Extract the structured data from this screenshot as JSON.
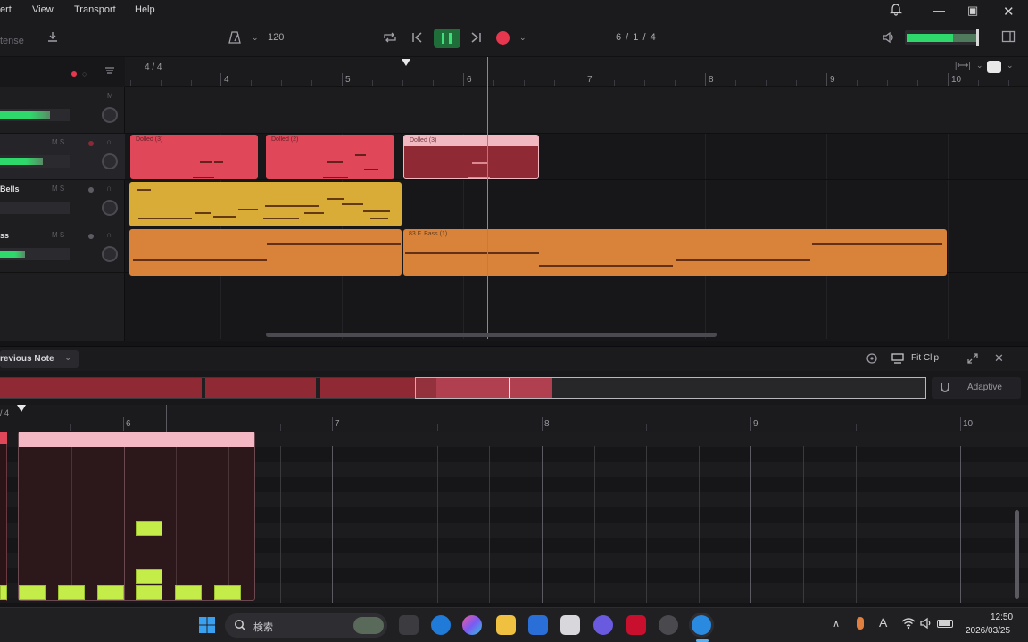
{
  "menu": {
    "items": [
      "ert",
      "View",
      "Transport",
      "Help"
    ]
  },
  "toolbar": {
    "left_label": "tense",
    "tempo": "120",
    "position": "6 / 1 / 4"
  },
  "ruler": {
    "time_signature": "4 / 4",
    "bars": [
      "4",
      "5",
      "6",
      "7",
      "8",
      "9",
      "10"
    ]
  },
  "tracks": [
    {
      "name": "",
      "ctrl": "M"
    },
    {
      "name": "",
      "ctrl": "M  S"
    },
    {
      "name": "Bells",
      "ctrl": "M  S"
    },
    {
      "name": "ss",
      "ctrl": "M  S"
    }
  ],
  "clips": {
    "drums_1": "Dolled (3)",
    "drums_2": "Dolled (2)",
    "drums_3": "Dolled (3)",
    "bass_2": "83 F. Bass (1)"
  },
  "editor": {
    "mode_label": "revious Note",
    "fit_clip_label": "Fit Clip",
    "snap_label": "Adaptive",
    "time_signature": "/ 4",
    "bars": [
      "6",
      "7",
      "8",
      "9",
      "10"
    ]
  },
  "taskbar": {
    "search_placeholder": "検索",
    "time": "12:50",
    "date": "2026/03/25"
  },
  "colors": {
    "drums": "#e0485a",
    "drums_selected": "#8f2a35",
    "bells": "#d8ac36",
    "bass": "#d8823a",
    "notes": "#c4ed4a",
    "meter": "#2fd86a",
    "record": "#e6374f"
  }
}
